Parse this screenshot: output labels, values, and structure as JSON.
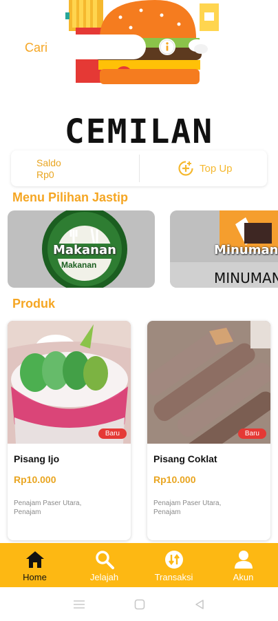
{
  "search": {
    "label": "Cari",
    "placeholder": ""
  },
  "brand": {
    "title": "CEMILAN"
  },
  "balance": {
    "label": "Saldo",
    "amount": "Rp0",
    "topup_label": "Top Up"
  },
  "jastip": {
    "title": "Menu Pilihan Jastip",
    "items": [
      {
        "caption": "Makanan",
        "logo_text": "Makanan"
      },
      {
        "caption": "Minuman",
        "logo_text": "MINUMAN"
      }
    ]
  },
  "products": {
    "title": "Produk",
    "items": [
      {
        "name": "Pisang Ijo",
        "price": "Rp10.000",
        "location": "Penajam Paser Utara, Penajam",
        "badge": "Baru"
      },
      {
        "name": "Pisang Coklat",
        "price": "Rp10.000",
        "location": "Penajam Paser Utara, Penajam",
        "badge": "Baru"
      }
    ]
  },
  "nav": {
    "items": [
      {
        "label": "Home",
        "icon": "home-icon"
      },
      {
        "label": "Jelajah",
        "icon": "search-icon"
      },
      {
        "label": "Transaksi",
        "icon": "transaction-icon"
      },
      {
        "label": "Akun",
        "icon": "account-icon"
      }
    ],
    "active": "Home"
  },
  "colors": {
    "accent": "#F5A623",
    "nav_bg": "#FDB813",
    "badge": "#E53935"
  }
}
